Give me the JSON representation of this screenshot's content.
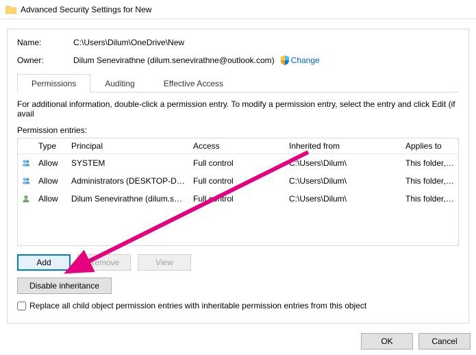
{
  "window": {
    "title": "Advanced Security Settings for New"
  },
  "panel": {
    "name_label": "Name:",
    "name_value": "C:\\Users\\Dilum\\OneDrive\\New",
    "owner_label": "Owner:",
    "owner_value": "Dilum Senevirathne (dilum.senevirathne@outlook.com)",
    "change_link": "Change"
  },
  "tabs": {
    "permissions": "Permissions",
    "auditing": "Auditing",
    "effective_access": "Effective Access"
  },
  "info_text": "For additional information, double-click a permission entry. To modify a permission entry, select the entry and click Edit (if avail",
  "perm_entries_label": "Permission entries:",
  "headers": {
    "type": "Type",
    "principal": "Principal",
    "access": "Access",
    "inherited": "Inherited from",
    "applies": "Applies to"
  },
  "entries": [
    {
      "icon": "users",
      "type": "Allow",
      "principal": "SYSTEM",
      "access": "Full control",
      "inherited": "C:\\Users\\Dilum\\",
      "applies": "This folder, subfolders an"
    },
    {
      "icon": "users",
      "type": "Allow",
      "principal": "Administrators (DESKTOP-DUI...",
      "access": "Full control",
      "inherited": "C:\\Users\\Dilum\\",
      "applies": "This folder, subfolders an"
    },
    {
      "icon": "user",
      "type": "Allow",
      "principal": "Dilum Senevirathne (dilum.se...",
      "access": "Full control",
      "inherited": "C:\\Users\\Dilum\\",
      "applies": "This folder, subfolders an"
    }
  ],
  "buttons": {
    "add": "Add",
    "remove": "Remove",
    "view": "View",
    "disable_inheritance": "Disable inheritance",
    "ok": "OK",
    "cancel": "Cancel"
  },
  "checkbox_label": "Replace all child object permission entries with inheritable permission entries from this object"
}
